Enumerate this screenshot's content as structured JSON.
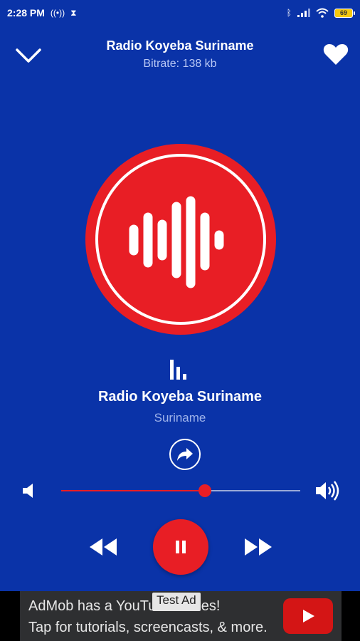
{
  "colors": {
    "background": "#0a33a8",
    "accent_red": "#e81e25",
    "subtitle": "#b9c8f5",
    "ad_background": "#2e2f31"
  },
  "status_bar": {
    "time": "2:28 PM",
    "battery": "69",
    "icons": [
      "hotspot-icon",
      "hourglass-icon",
      "bluetooth-icon",
      "signal-icon",
      "wifi-icon",
      "battery-icon"
    ]
  },
  "header": {
    "title": "Radio Koyeba Suriname",
    "subtitle": "Bitrate: 138 kb",
    "left_icon": "chevron-down-icon",
    "right_icon": "heart-icon"
  },
  "now_playing": {
    "station": "Radio Koyeba Suriname",
    "country": "Suriname",
    "logo_icon": "soundwave-logo-icon",
    "share_icon": "share-icon"
  },
  "volume": {
    "level": 0.6,
    "low_icon": "volume-low-icon",
    "high_icon": "volume-high-icon"
  },
  "controls": {
    "rewind_icon": "rewind-icon",
    "pause_icon": "pause-icon",
    "forward_icon": "fast-forward-icon"
  },
  "ad": {
    "tag": "Test Ad",
    "line1": "AdMob has a YouTube Series!",
    "line2": "Tap for tutorials, screencasts, & more."
  }
}
